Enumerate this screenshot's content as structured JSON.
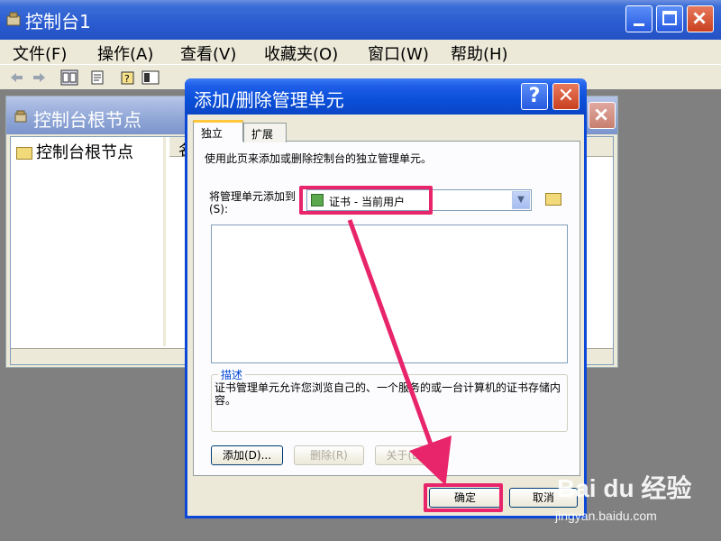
{
  "window": {
    "title": "控制台1"
  },
  "menu": [
    "文件(F)",
    "操作(A)",
    "查看(V)",
    "收藏夹(O)",
    "窗口(W)",
    "帮助(H)"
  ],
  "child": {
    "title": "控制台根节点",
    "tree_root": "控制台根节点",
    "list_header": "名"
  },
  "dialog": {
    "title": "添加/删除管理单元",
    "help_glyph": "?",
    "close_glyph": "✕",
    "tabs": [
      "独立",
      "扩展"
    ],
    "intro": "使用此页来添加或删除控制台的独立管理单元。",
    "addto_label": "将管理单元添加到(S):",
    "combo_value": "证书 - 当前用户",
    "desc_legend": "描述",
    "desc_text": "证书管理单元允许您浏览自己的、一个服务的或一台计算机的证书存储内容。",
    "buttons": {
      "add": "添加(D)...",
      "remove": "删除(R)",
      "about": "关于(B)...",
      "ok": "确定",
      "cancel": "取消"
    }
  },
  "watermark": {
    "main": "Bai du 经验",
    "sub": "jingyan.baidu.com"
  },
  "colors": {
    "highlight": "#e8246a",
    "xp_blue": "#0a4fd9"
  }
}
